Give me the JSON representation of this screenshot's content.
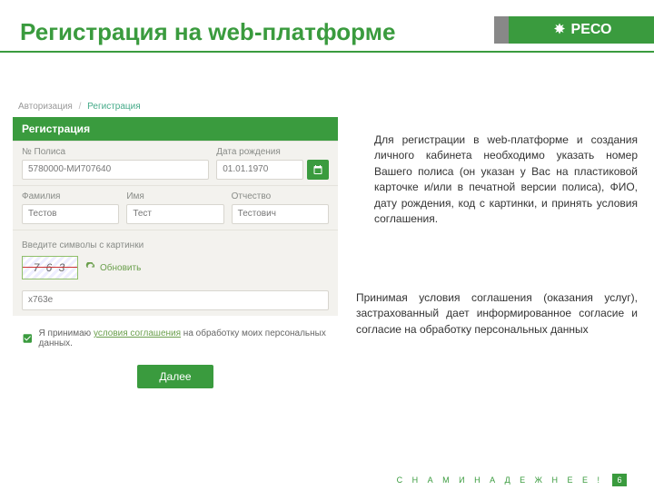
{
  "header": {
    "title": "Регистрация на web-платформе",
    "logo_text": "РЕСО"
  },
  "breadcrumb": {
    "a": "Авторизация",
    "sep": "/",
    "b": "Регистрация"
  },
  "form": {
    "head": "Регистрация",
    "policy_label": "№ Полиса",
    "policy_value": "5780000-МИ707640",
    "dob_label": "Дата рождения",
    "dob_value": "01.01.1970",
    "lname_label": "Фамилия",
    "lname_value": "Тестов",
    "fname_label": "Имя",
    "fname_value": "Тест",
    "mname_label": "Отчество",
    "mname_value": "Тестович",
    "captcha_label": "Введите символы с картинки",
    "captcha_image_text": "7 6 3",
    "refresh": "Обновить",
    "captcha_value": "x763e",
    "accept_prefix": "Я принимаю ",
    "accept_link": "условия соглашения",
    "accept_suffix": " на обработку моих персональных данных.",
    "submit": "Далее"
  },
  "desc": {
    "p1": "Для регистрации в web-платформе и создания личного кабинета необходимо указать номер Вашего полиса (он указан у Вас на пластиковой карточке и/или в печатной версии полиса), ФИО, дату рождения, код с картинки, и принять условия соглашения.",
    "p2": "Принимая условия соглашения (оказания услуг), застрахованный дает информированное согласие и согласие на обработку персональных данных"
  },
  "footer": {
    "tagline": "С  Н А М И  Н А Д Е Ж Н Е Е !",
    "page": "6"
  }
}
